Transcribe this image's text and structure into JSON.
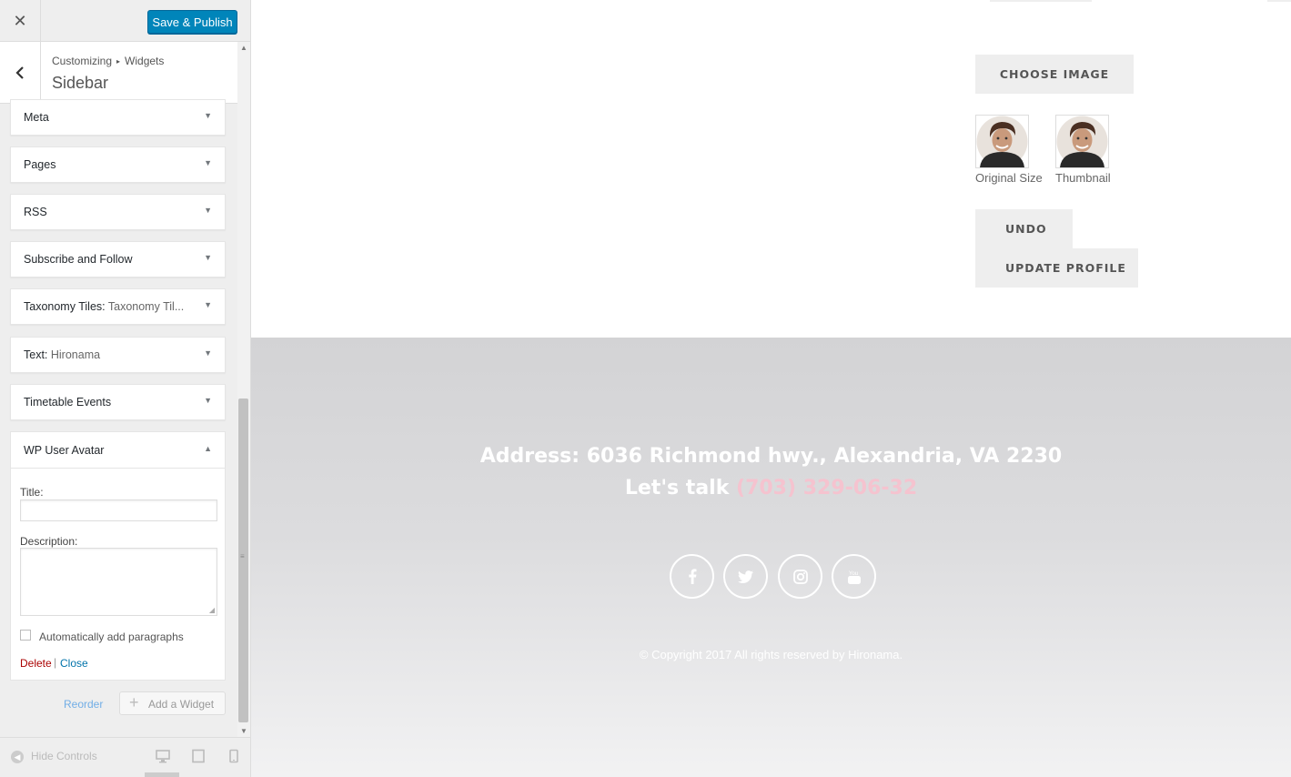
{
  "customizer": {
    "close_icon": "close-icon",
    "publish_label": "Save & Publish",
    "breadcrumb": {
      "first": "Customizing",
      "separator": "▸",
      "second": "Widgets"
    },
    "section_title": "Sidebar",
    "widgets": [
      {
        "title": "Meta",
        "subtitle": ""
      },
      {
        "title": "Pages",
        "subtitle": ""
      },
      {
        "title": "RSS",
        "subtitle": ""
      },
      {
        "title": "Subscribe and Follow",
        "subtitle": ""
      },
      {
        "title": "Taxonomy Tiles:",
        "subtitle": " Taxonomy Til..."
      },
      {
        "title": "Text:",
        "subtitle": " Hironama"
      },
      {
        "title": "Timetable Events",
        "subtitle": ""
      }
    ],
    "open_widget": {
      "title": "WP User Avatar",
      "title_label": "Title:",
      "title_value": "",
      "description_label": "Description:",
      "description_value": "",
      "autop_label": "Automatically add paragraphs",
      "autop_checked": false,
      "delete_label": "Delete",
      "separator": "|",
      "close_label": "Close"
    },
    "reorder_label": "Reorder",
    "add_widget_label": "Add a Widget",
    "hide_controls_label": "Hide Controls",
    "devices": [
      "desktop",
      "tablet",
      "mobile"
    ],
    "active_device": "desktop"
  },
  "preview": {
    "choose_image_label": "CHOOSE IMAGE",
    "avatar_original_caption": "Original Size",
    "avatar_thumbnail_caption": "Thumbnail",
    "undo_label": "UNDO",
    "update_label": "UPDATE PROFILE",
    "footer": {
      "address": "Address: 6036 Richmond hwy., Alexandria, VA 2230",
      "talk_prefix": "Let's talk",
      "phone": "(703) 329-06-32",
      "social": [
        "facebook",
        "twitter",
        "instagram",
        "youtube"
      ],
      "copyright": "© Copyright 2017 All rights reserved by Hironama."
    }
  },
  "colors": {
    "primary_button": "#0085ba",
    "delete_link": "#a00000",
    "close_link": "#0073aa",
    "phone_accent": "#f5c3cf",
    "footer_bg": "#d3d3d5"
  }
}
